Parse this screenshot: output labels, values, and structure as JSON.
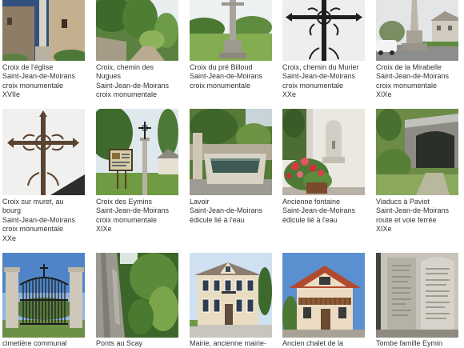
{
  "gallery": {
    "cards": [
      {
        "title_lines": [
          "Croix de l'église"
        ],
        "commune": "Saint-Jean-de-Moirans",
        "category": "croix monumentale",
        "century": "XVIIe"
      },
      {
        "title_lines": [
          "Croix, chemin des",
          "Nugues"
        ],
        "commune": "Saint-Jean-de-Moirans",
        "category": "croix monumentale"
      },
      {
        "title_lines": [
          "Croix du pré Billoud"
        ],
        "commune": "Saint-Jean-de-Moirans",
        "category": "croix monumentale"
      },
      {
        "title_lines": [
          "Croix, chemin du Murier"
        ],
        "commune": "Saint-Jean-de-Moirans",
        "category": "croix monumentale",
        "century": "XXe"
      },
      {
        "title_lines": [
          "Croix de la Mirabelle"
        ],
        "commune": "Saint-Jean-de-Moirans",
        "category": "croix monumentale",
        "century": "XIXe"
      },
      {
        "title_lines": [
          "Croix sur muret, au",
          "bourg"
        ],
        "commune": "Saint-Jean-de-Moirans",
        "category": "croix monumentale",
        "century": "XXe"
      },
      {
        "title_lines": [
          "Croix des Eymins"
        ],
        "commune": "Saint-Jean-de-Moirans",
        "category": "croix monumentale",
        "century": "XIXe"
      },
      {
        "title_lines": [
          "Lavoir"
        ],
        "commune": "Saint-Jean-de-Moirans",
        "category": "édicule lié à l'eau"
      },
      {
        "title_lines": [
          "Ancienne fontaine"
        ],
        "commune": "Saint-Jean-de-Moirans",
        "category": "édicule lié à l'eau"
      },
      {
        "title_lines": [
          "Viaducs à Paviot"
        ],
        "commune": "Saint-Jean-de-Moirans",
        "category": "route et voie ferrée",
        "century": "XIXe"
      },
      {
        "title_lines": [
          "cimetière communal"
        ]
      },
      {
        "title_lines": [
          "Ponts au Scay"
        ]
      },
      {
        "title_lines": [
          "Mairie, ancienne mairie-"
        ]
      },
      {
        "title_lines": [
          "Ancien chalet de la"
        ]
      },
      {
        "title_lines": [
          "Tombe famille Eymin"
        ]
      }
    ]
  }
}
